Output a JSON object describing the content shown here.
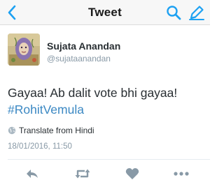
{
  "navbar": {
    "title": "Tweet",
    "back_icon": "chevron-left-icon",
    "search_icon": "search-icon",
    "compose_icon": "compose-icon",
    "accent_color": "#1da1f2"
  },
  "tweet": {
    "author_name": "Sujata Anandan",
    "author_handle": "@sujataanandan",
    "text": "Gayaa! Ab dalit vote bhi gayaa!",
    "hashtag": "#RohitVemula",
    "translate_label": "Translate from Hindi",
    "timestamp": "18/01/2016, 11:50",
    "hashtag_color": "#3b88c3"
  },
  "actions": {
    "reply_icon": "reply-icon",
    "retweet_icon": "retweet-icon",
    "like_icon": "heart-icon",
    "more_icon": "more-dots-icon"
  }
}
